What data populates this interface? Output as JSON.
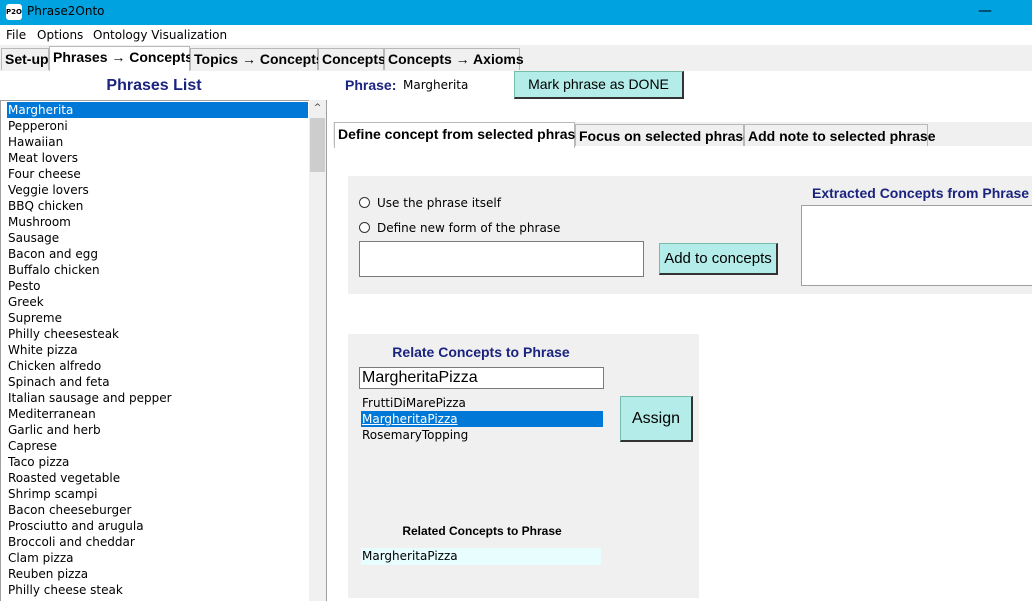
{
  "window": {
    "title": "Phrase2Onto",
    "icon_text": "P2O",
    "minimize": "—"
  },
  "menu": [
    "File",
    "Options",
    "Ontology Visualization"
  ],
  "tabs": [
    "Set-up",
    "Phrases → Concepts",
    "Topics → Concepts",
    "Concepts",
    "Concepts → Axioms"
  ],
  "active_tab": "Phrases → Concepts",
  "phrases_panel": {
    "title": "Phrases List",
    "items": [
      "Margherita",
      "Pepperoni",
      "Hawaiian",
      "Meat lovers",
      "Four cheese",
      "Veggie lovers",
      "BBQ chicken",
      "Mushroom",
      "Sausage",
      "Bacon and egg",
      "Buffalo chicken",
      "Pesto",
      "Greek",
      "Supreme",
      "Philly cheesesteak",
      "White pizza",
      "Chicken alfredo",
      "Spinach and feta",
      "Italian sausage and pepper",
      "Mediterranean",
      "Garlic and herb",
      "Caprese",
      "Taco pizza",
      "Roasted vegetable",
      "Shrimp scampi",
      "Bacon cheeseburger",
      "Prosciutto and arugula",
      "Broccoli and cheddar",
      "Clam pizza",
      "Reuben pizza",
      "Philly cheese steak"
    ],
    "selected": "Margherita",
    "scroll_up": "^"
  },
  "phrase_header": {
    "label": "Phrase:",
    "value": "Margherita",
    "done_button": "Mark phrase as DONE"
  },
  "inner_tabs": [
    "Define concept from selected phrase",
    "Focus on selected phrase",
    "Add note to selected phrase"
  ],
  "define": {
    "option_use": "Use the phrase itself",
    "option_new": "Define new form of the phrase",
    "new_form_value": "",
    "add_button": "Add to concepts",
    "extracted_title": "Extracted Concepts from Phrase"
  },
  "relate": {
    "title": "Relate Concepts to Phrase",
    "input_value": "MargheritaPizza",
    "concepts": [
      "FruttiDiMarePizza",
      "MargheritaPizza",
      "RosemaryTopping"
    ],
    "selected": "MargheritaPizza",
    "assign_button": "Assign",
    "related_title": "Related Concepts to Phrase",
    "related": [
      "MargheritaPizza"
    ]
  },
  "colors": {
    "titlebar": "#00a2e0",
    "selection": "#0078d7",
    "button": "#b3ece8",
    "heading": "#1a237e"
  }
}
